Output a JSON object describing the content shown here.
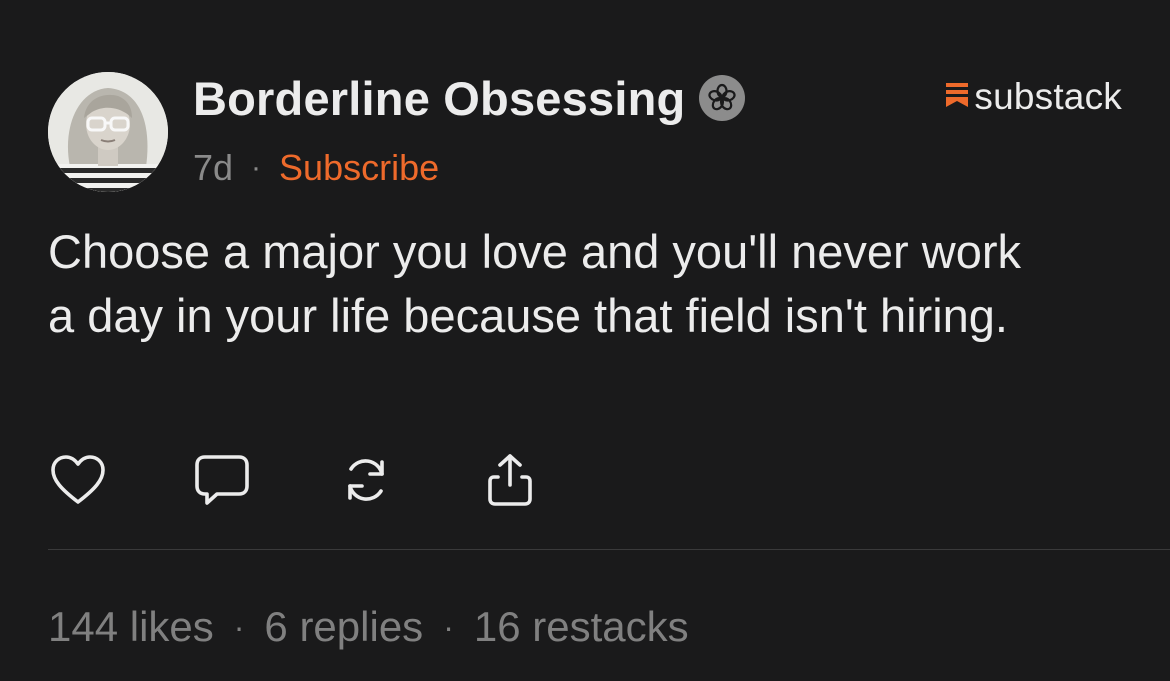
{
  "post": {
    "author_name": "Borderline Obsessing",
    "age": "7d",
    "separator": "·",
    "subscribe_label": "Subscribe",
    "text": "Choose a major you love and you'll never work a day in your life because that field isn't hiring."
  },
  "brand": {
    "name": "substack",
    "accent": "#ee6a2b"
  },
  "actions": {
    "icons": [
      "heart-icon",
      "comment-icon",
      "restack-icon",
      "share-icon"
    ]
  },
  "stats": {
    "likes": "144 likes",
    "replies": "6 replies",
    "restacks": "16 restacks",
    "separator": "·"
  },
  "colors": {
    "background": "#1a1a1b",
    "text": "#ececec",
    "muted": "#808080",
    "accent": "#ee6a2b"
  }
}
